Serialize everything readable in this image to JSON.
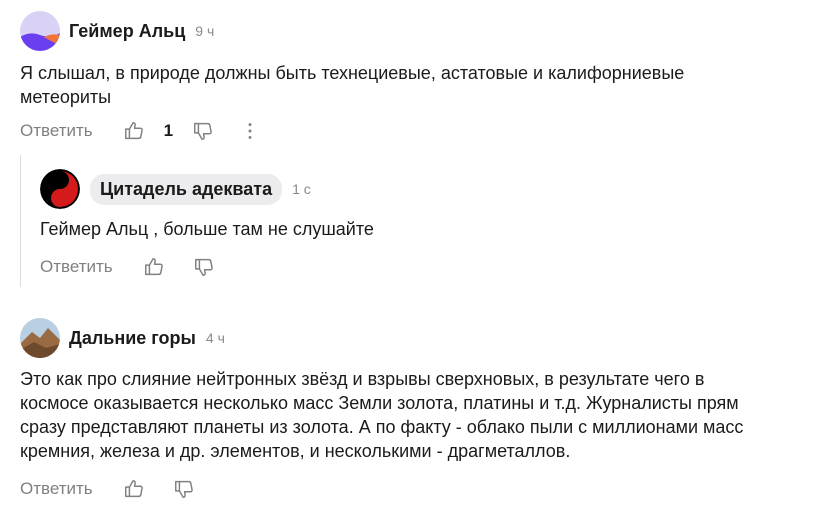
{
  "comments": [
    {
      "author": "Геймер Альц",
      "time": "9 ч",
      "text_line1": "Я слышал, в природе должны быть технециевые, астатовые и калифорниевые",
      "text_line2": "метеориты",
      "reply_label": "Ответить",
      "likes": "1"
    },
    {
      "author": "Цитадель адеквата",
      "time": "1 с",
      "text": "Геймер Альц , больше там не слушайте",
      "reply_label": "Ответить"
    },
    {
      "author": "Дальние горы",
      "time": "4 ч",
      "lines": [
        "Это как про слияние нейтронных звёзд и взрывы сверхновых, в результате чего в",
        "космосе оказывается несколько масс Земли золота, платины и т.д. Журналисты прям",
        "сразу представляют планеты из золота. А по факту - облако пыли с миллионами масс",
        "кремния, железа и др. элементов, и несколькими - драгметаллов."
      ],
      "reply_label": "Ответить"
    }
  ],
  "icons": {
    "like": "thumbs-up-icon",
    "dislike": "thumbs-down-icon",
    "more": "more-vertical-icon"
  },
  "colors": {
    "muted": "#808080",
    "time": "#8a8a8a",
    "chip_bg": "#ececee"
  }
}
